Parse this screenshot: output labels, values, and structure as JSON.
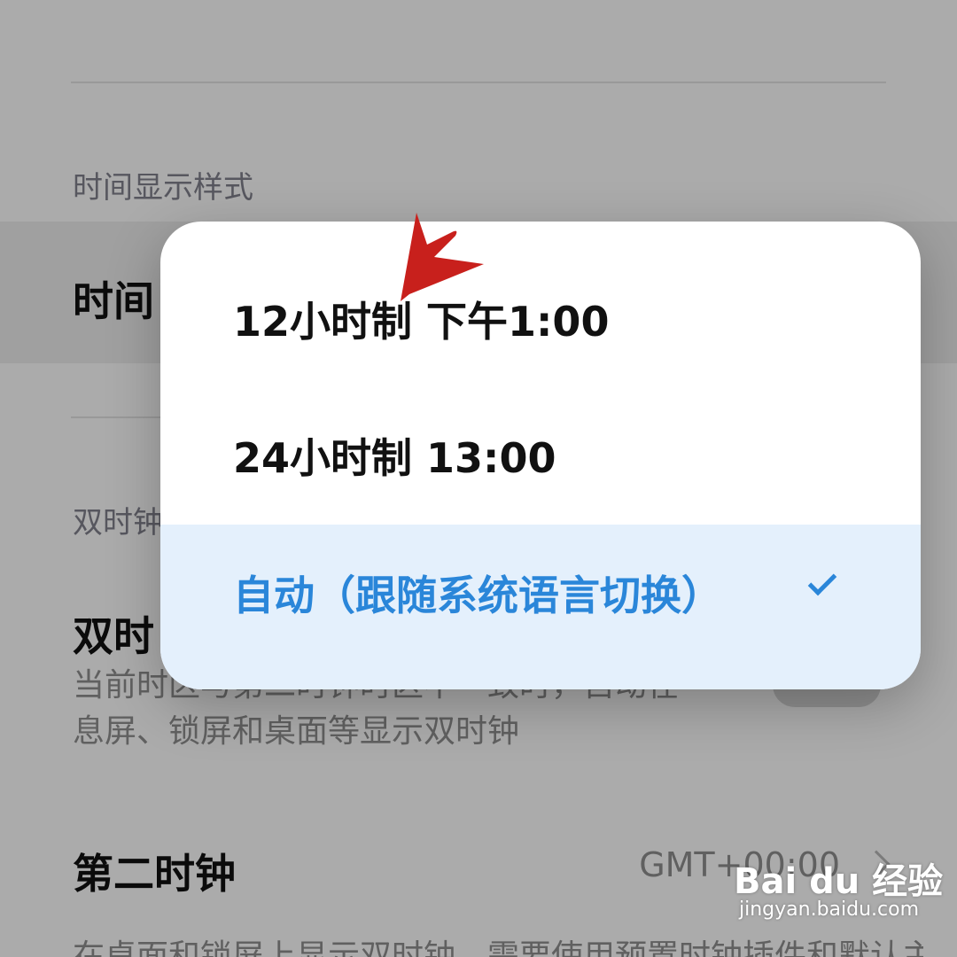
{
  "settings": {
    "time_display_header": "时间显示样式",
    "time_row_title": "时间",
    "dual_clock_header": "双时钟",
    "dual_clock_row_title": "双时",
    "dual_clock_desc_line1": "当前时区与第二时钟时区不一致时，自动在",
    "dual_clock_desc_line2": "息屏、锁屏和桌面等显示双时钟",
    "second_clock_title": "第二时钟",
    "second_clock_value": "GMT+00:00",
    "second_clock_desc": "在桌面和锁屏上显示双时钟，需要使用预置时钟插件和默认主题"
  },
  "dialog": {
    "options": [
      {
        "label": "12小时制 下午1:00",
        "selected": false
      },
      {
        "label": "24小时制 13:00",
        "selected": false
      },
      {
        "label": "自动（跟随系统语言切换）",
        "selected": true
      }
    ]
  },
  "watermark": {
    "brand": "Bai du 经验",
    "url": "jingyan.baidu.com"
  },
  "colors": {
    "accent": "#2a86d9",
    "selected_bg": "#e4f0fc",
    "annotation_arrow": "#c8201c"
  },
  "icons": {
    "selected_marker": "check-icon",
    "row_chevron": "chevron-right-icon",
    "annotation": "red-arrow-pointer"
  }
}
